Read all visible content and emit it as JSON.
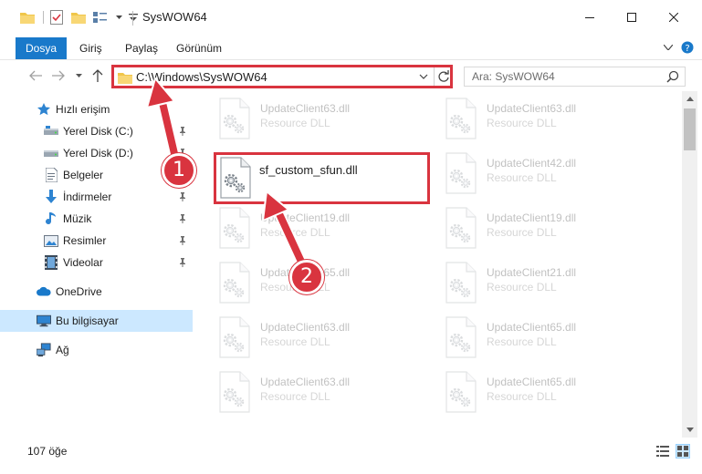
{
  "window": {
    "title": "SysWOW64"
  },
  "ribbon": {
    "tabs": [
      {
        "label": "Dosya",
        "active": true
      },
      {
        "label": "Giriş"
      },
      {
        "label": "Paylaş"
      },
      {
        "label": "Görünüm"
      }
    ]
  },
  "address": {
    "path": "C:\\Windows\\SysWOW64",
    "search_placeholder": "Ara: SysWOW64"
  },
  "sidebar": {
    "items": [
      {
        "label": "Hızlı erişim",
        "icon": "star-icon"
      },
      {
        "label": "Yerel Disk (C:)",
        "icon": "drive-icon",
        "pinned": true
      },
      {
        "label": "Yerel Disk (D:)",
        "icon": "drive-icon",
        "pinned": true
      },
      {
        "label": "Belgeler",
        "icon": "documents-icon",
        "pinned": true
      },
      {
        "label": "İndirmeler",
        "icon": "download-icon",
        "pinned": true
      },
      {
        "label": "Müzik",
        "icon": "music-icon",
        "pinned": true
      },
      {
        "label": "Resimler",
        "icon": "pictures-icon",
        "pinned": true
      },
      {
        "label": "Videolar",
        "icon": "videos-icon",
        "pinned": true
      },
      {
        "label": "OneDrive",
        "icon": "cloud-icon"
      },
      {
        "label": "Bu bilgisayar",
        "icon": "computer-icon",
        "selected": true
      },
      {
        "label": "Ağ",
        "icon": "network-icon"
      }
    ]
  },
  "files": {
    "left_column": [
      {
        "name": "UpdateClient63.dll",
        "type": "Resource DLL"
      },
      {
        "name": "sf_custom_sfun.dll",
        "type": ""
      },
      {
        "name": "UpdateClient19.dll",
        "type": "Resource DLL"
      },
      {
        "name": "UpdateClient65.dll",
        "type": "Resource DLL"
      },
      {
        "name": "UpdateClient63.dll",
        "type": "Resource DLL"
      },
      {
        "name": "UpdateClient63.dll",
        "type": "Resource DLL"
      }
    ],
    "right_column": [
      {
        "name": "UpdateClient63.dll",
        "type": "Resource DLL"
      },
      {
        "name": "UpdateClient42.dll",
        "type": "Resource DLL"
      },
      {
        "name": "UpdateClient19.dll",
        "type": "Resource DLL"
      },
      {
        "name": "UpdateClient21.dll",
        "type": "Resource DLL"
      },
      {
        "name": "UpdateClient65.dll",
        "type": "Resource DLL"
      },
      {
        "name": "UpdateClient65.dll",
        "type": "Resource DLL"
      }
    ]
  },
  "status": {
    "item_count": "107 öğe"
  },
  "annotations": {
    "step1": "1",
    "step2": "2",
    "color": "#d9343f"
  },
  "colors": {
    "accent": "#1979ca",
    "selection": "#cce8ff"
  }
}
